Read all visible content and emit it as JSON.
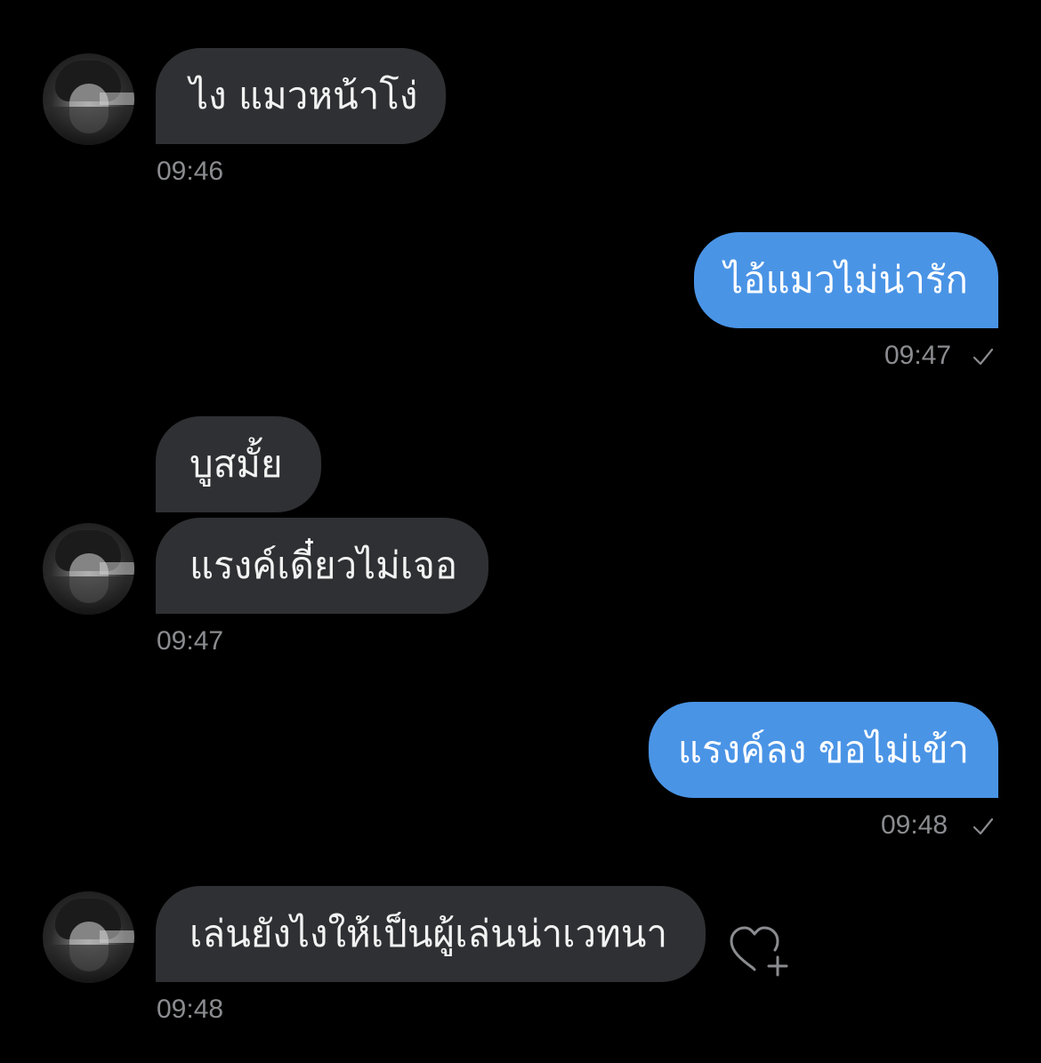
{
  "messages": [
    {
      "side": "in",
      "text": "ไง แมวหน้าโง่",
      "time": "09:46"
    },
    {
      "side": "out",
      "text": "ไอ้แมวไม่น่ารัก",
      "time": "09:47"
    },
    {
      "side": "in",
      "text": "บูสมั้ย"
    },
    {
      "side": "in",
      "text": "แรงค์เดี๋ยวไม่เจอ",
      "time": "09:47"
    },
    {
      "side": "out",
      "text": "แรงค์ลง ขอไม่เข้า",
      "time": "09:48"
    },
    {
      "side": "in",
      "text": "เล่นยังไงให้เป็นผู้เล่นน่าเวทนา",
      "time": "09:48"
    }
  ],
  "colors": {
    "background": "#000000",
    "incoming_bubble": "#2f3033",
    "outgoing_bubble": "#4a94e6",
    "timestamp": "#8b8c90"
  },
  "icons": {
    "sent": "checkmark-icon",
    "react": "heart-plus-icon",
    "avatar": "avatar"
  }
}
